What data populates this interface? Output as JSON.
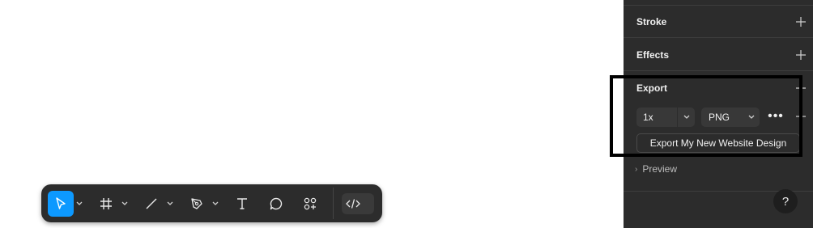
{
  "panel": {
    "stroke": {
      "title": "Stroke"
    },
    "effects": {
      "title": "Effects"
    },
    "export": {
      "title": "Export",
      "scale_value": "1x",
      "format_value": "PNG",
      "more_label": "•••",
      "export_button_label": "Export My New Website Design"
    },
    "preview": {
      "label": "Preview"
    },
    "help_label": "?"
  },
  "toolbar": {
    "tools": [
      {
        "name": "move-tool",
        "icon": "cursor-arrow-icon",
        "active": true
      },
      {
        "name": "frame-tool",
        "icon": "frame-hash-icon"
      },
      {
        "name": "line-tool",
        "icon": "line-icon"
      },
      {
        "name": "pen-tool",
        "icon": "pen-icon"
      },
      {
        "name": "text-tool",
        "icon": "text-T-icon"
      },
      {
        "name": "comment-tool",
        "icon": "comment-bubble-icon"
      },
      {
        "name": "actions-tool",
        "icon": "shapes-plus-icon"
      }
    ],
    "dev_mode": {
      "icon": "code-brackets-icon"
    }
  },
  "colors": {
    "panel_bg": "#2c2c2c",
    "accent": "#0d99ff",
    "highlight_border": "#000000"
  }
}
